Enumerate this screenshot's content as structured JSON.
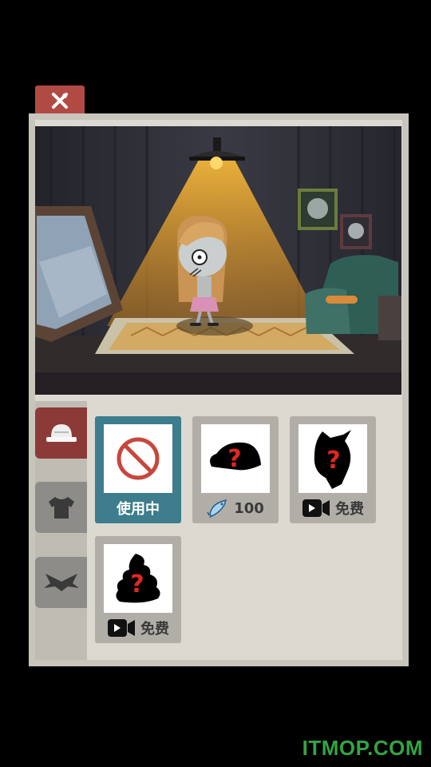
{
  "colors": {
    "accent_red": "#b24a44",
    "selected_teal": "#3d7d8d",
    "watermark_green": "#33a444"
  },
  "close_button": {
    "icon": "crossed-tools-icon"
  },
  "scene": {
    "description_icon": "room-scene"
  },
  "categories": [
    {
      "icon": "hat-icon",
      "active": true
    },
    {
      "icon": "shirt-icon",
      "active": false
    },
    {
      "icon": "wings-icon",
      "active": false
    }
  ],
  "items": [
    {
      "icon": "no-item-icon",
      "label": "使用中",
      "selected": true
    },
    {
      "icon": "mystery-hat-icon",
      "price": "100",
      "currency_icon": "fish-icon"
    },
    {
      "icon": "mystery-hair-icon",
      "label": "免费",
      "action_icon": "video-icon"
    },
    {
      "icon": "mystery-poop-icon",
      "label": "免费",
      "action_icon": "video-icon"
    }
  ],
  "watermark": "ITMOP.COM"
}
